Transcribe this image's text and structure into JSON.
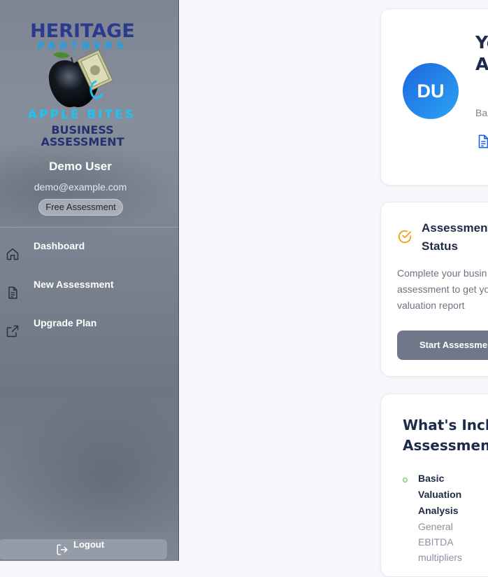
{
  "sidebar": {
    "logo": {
      "line1": "HERITAGE",
      "line2": "PARTNERS",
      "line3": "APPLE BITES",
      "line4": "BUSINESS",
      "line5": "ASSESSMENT"
    },
    "user": {
      "name": "Demo User",
      "email": "demo@example.com",
      "plan": "Free Assessment"
    },
    "nav": [
      {
        "label": "Dashboard",
        "icon": "home-icon"
      },
      {
        "label": "New Assessment",
        "icon": "document-icon"
      },
      {
        "label": "Upgrade Plan",
        "icon": "external-link-icon"
      }
    ],
    "logout": {
      "label": "Logout",
      "icon": "logout-icon"
    }
  },
  "main": {
    "profile_card": {
      "avatar_initials": "DU",
      "title_fragment": "Yo A D",
      "subtitle_fragment": "Bas",
      "icon": "document-icon"
    },
    "status_card": {
      "icon": "check-circle-icon",
      "title": "Assessment Status",
      "description": "Complete your busin assessment to get yo valuation report",
      "button_label": "Start Assessment"
    },
    "included_card": {
      "title": "What's Included Assessment",
      "features": [
        {
          "title": "Basic Valuation Analysis",
          "description": "General EBITDA multipliers"
        }
      ]
    }
  },
  "colors": {
    "sidebar_bg": "#7d8594",
    "accent_blue": "#1e66e0",
    "status_icon": "#f0a11a",
    "button_gray": "#6f7789",
    "heading": "#1e2a4a"
  }
}
